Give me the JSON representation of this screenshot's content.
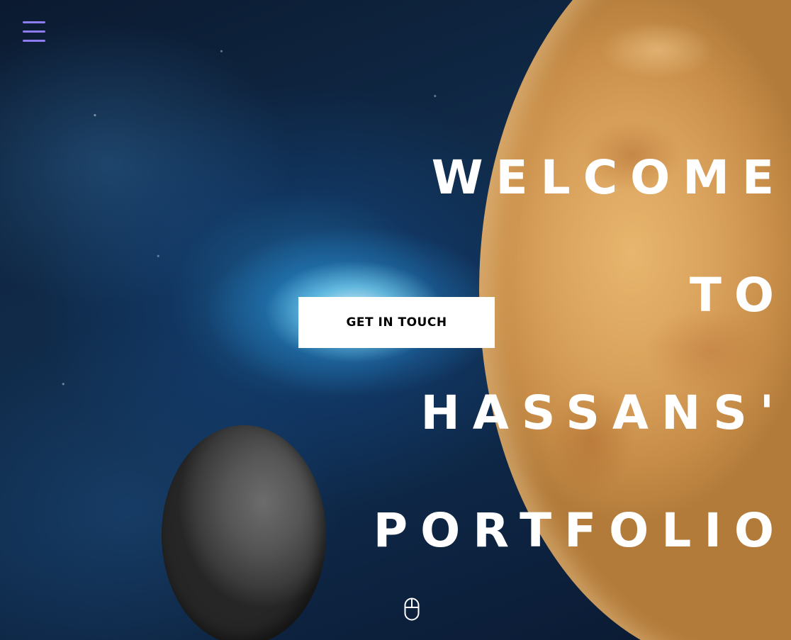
{
  "header": {
    "menu_icon": "hamburger-menu-icon",
    "menu_color": "#8d7cf0"
  },
  "hero": {
    "headline_lines": [
      "WELCOME",
      "TO",
      "HASSANS'",
      "PORTFOLIO"
    ],
    "cta_label": "GET IN TOUCH",
    "scroll_icon": "mouse-scroll-icon"
  }
}
